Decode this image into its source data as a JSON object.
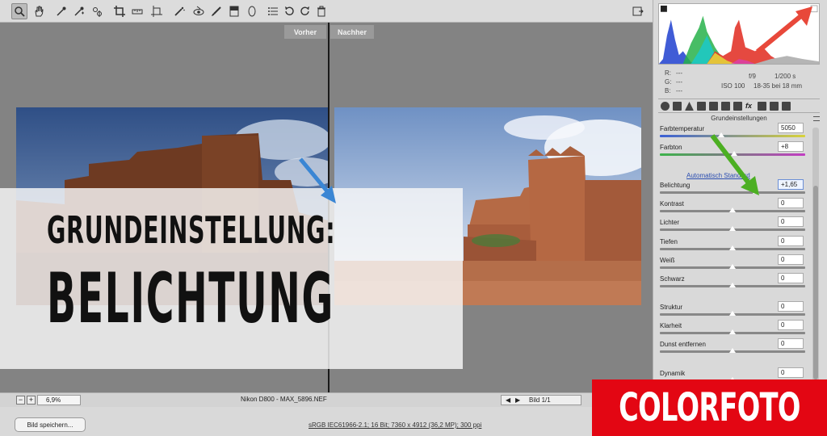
{
  "toolbar": {
    "tools": [
      {
        "icon": "zoom-icon",
        "active": true
      },
      {
        "icon": "hand-icon"
      },
      {
        "icon": "white-balance-eyedropper-icon"
      },
      {
        "icon": "color-sampler-icon"
      },
      {
        "icon": "target-adjustment-icon"
      },
      {
        "icon": "crop-icon"
      },
      {
        "icon": "straighten-icon"
      },
      {
        "icon": "transform-icon"
      },
      {
        "icon": "spot-removal-icon"
      },
      {
        "icon": "red-eye-icon"
      },
      {
        "icon": "adjustment-brush-icon"
      },
      {
        "icon": "graduated-filter-icon"
      },
      {
        "icon": "radial-filter-icon"
      },
      {
        "icon": "presets-icon"
      },
      {
        "icon": "rotate-left-icon"
      },
      {
        "icon": "rotate-right-icon"
      },
      {
        "icon": "trash-icon"
      }
    ],
    "right_icon": "fullscreen-icon"
  },
  "preview": {
    "before_label": "Vorher",
    "after_label": "Nachher",
    "zoom": "6,9%",
    "filename": "Nikon D800 - MAX_5896.NEF",
    "page": "Bild 1/1"
  },
  "status": {
    "save_button": "Bild speichern...",
    "info": "sRGB IEC61966-2.1; 16 Bit; 7360 x 4912 (36,2 MP); 300 ppi"
  },
  "readout": {
    "r": "R:",
    "g": "G:",
    "b": "B:",
    "r_val": "---",
    "g_val": "---",
    "b_val": "---",
    "aperture": "f/9",
    "shutter": "1/200 s",
    "iso": "ISO 100",
    "lens": "18-35 bei 18 mm"
  },
  "panel": {
    "section_title": "Grundeinstellungen",
    "auto_link": "Automatisch",
    "auto_link_tail": "Standard",
    "controls": [
      {
        "label": "Farbtemperatur",
        "value": "5050",
        "pos": 0.42
      },
      {
        "label": "Farbton",
        "value": "+8",
        "pos": 0.51
      },
      {
        "label": "Belichtung",
        "value": "+1,65",
        "pos": 0.66,
        "focus": true
      },
      {
        "label": "Kontrast",
        "value": "0",
        "pos": 0.5
      },
      {
        "label": "Lichter",
        "value": "0",
        "pos": 0.5
      },
      {
        "label": "Tiefen",
        "value": "0",
        "pos": 0.5
      },
      {
        "label": "Weiß",
        "value": "0",
        "pos": 0.5
      },
      {
        "label": "Schwarz",
        "value": "0",
        "pos": 0.5
      },
      {
        "label": "Struktur",
        "value": "0",
        "pos": 0.5
      },
      {
        "label": "Klarheit",
        "value": "0",
        "pos": 0.5
      },
      {
        "label": "Dunst entfernen",
        "value": "0",
        "pos": 0.5
      },
      {
        "label": "Dynamik",
        "value": "0",
        "pos": 0.5
      }
    ]
  },
  "overlay": {
    "line1": "GRUNDEINSTELLUNG:",
    "line2": "BELICHTUNG"
  },
  "logo": {
    "text": "COLORFOTO"
  },
  "colors": {
    "arrow_blue": "#3a86d4",
    "arrow_green": "#4caf22",
    "arrow_red": "#e8483a",
    "logo_red": "#e30613"
  }
}
